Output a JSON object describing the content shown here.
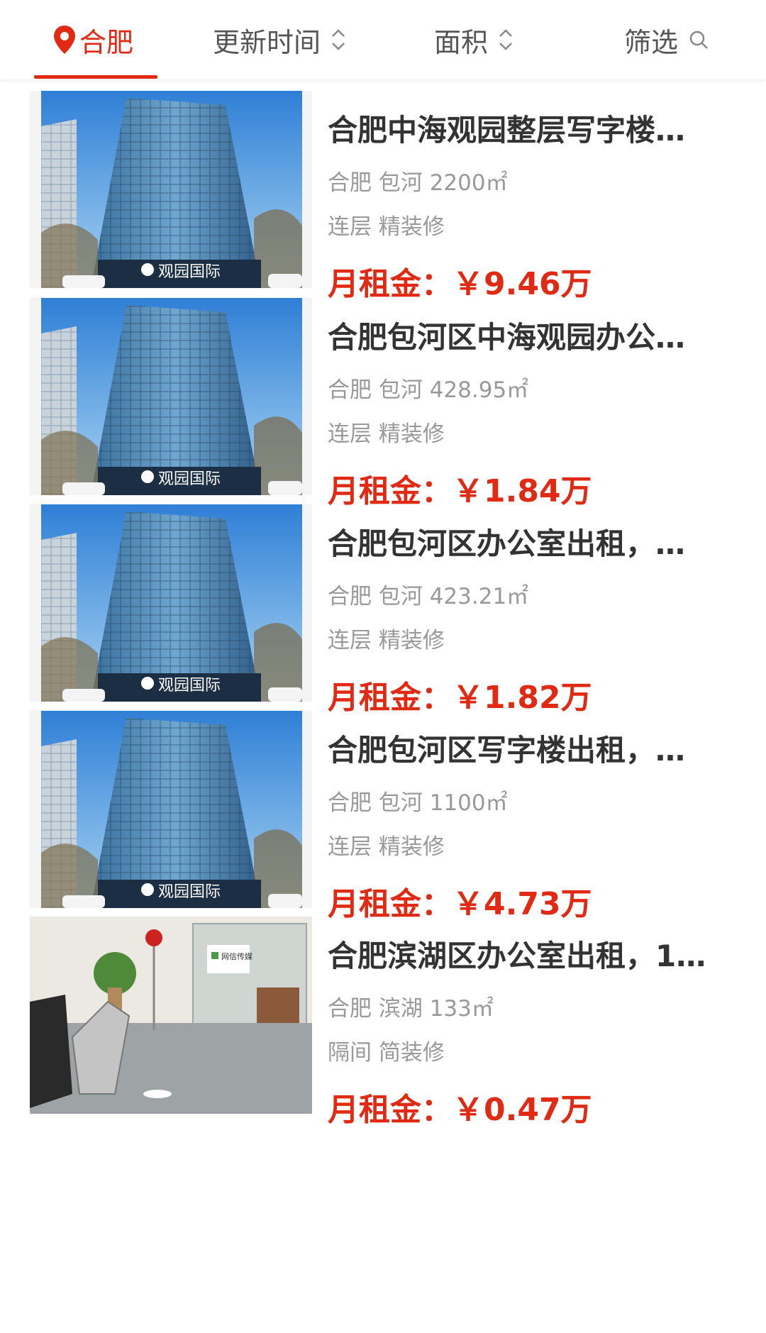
{
  "filters": {
    "city": "合肥",
    "update_time": "更新时间",
    "area": "面积",
    "filter": "筛选"
  },
  "colors": {
    "accent": "#e02a14",
    "title": "#333333",
    "meta": "#999999"
  },
  "listings": [
    {
      "title": "合肥中海观园整层写字楼…",
      "meta": "合肥 包河 2200㎡",
      "tags": "连层 精装修",
      "price_label": "月租金：",
      "price_value": "￥9.46万",
      "image": "building-photo"
    },
    {
      "title": "合肥包河区中海观园办公…",
      "meta": "合肥 包河 428.95㎡",
      "tags": "连层 精装修",
      "price_label": "月租金：",
      "price_value": "￥1.84万",
      "image": "building-photo"
    },
    {
      "title": "合肥包河区办公室出租，…",
      "meta": "合肥 包河 423.21㎡",
      "tags": "连层 精装修",
      "price_label": "月租金：",
      "price_value": "￥1.82万",
      "image": "building-photo"
    },
    {
      "title": "合肥包河区写字楼出租，…",
      "meta": "合肥 包河 1100㎡",
      "tags": "连层 精装修",
      "price_label": "月租金：",
      "price_value": "￥4.73万",
      "image": "building-photo"
    },
    {
      "title": "合肥滨湖区办公室出租，1…",
      "meta": "合肥 滨湖 133㎡",
      "tags": "隔间 简装修",
      "price_label": "月租金：",
      "price_value": "￥0.47万",
      "image": "office-interior-photo"
    }
  ]
}
